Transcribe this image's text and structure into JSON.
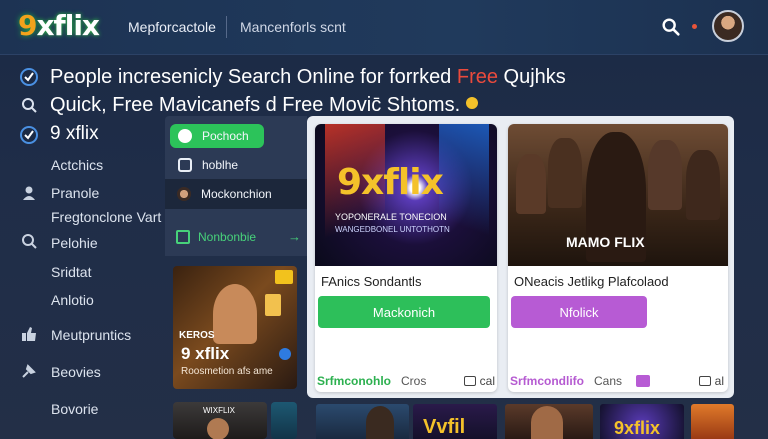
{
  "header": {
    "logo_nine": "9",
    "logo_xflix": "xflix",
    "nav_primary": "Mepforcactole",
    "nav_secondary": "Mancenforls scnt"
  },
  "headline": {
    "line1_main": "People incresenicly Search Online for forrked ",
    "line1_accent": "Free",
    "line1_tail": " Qujhks",
    "line2": "Quick, Free Mavicanefs d Free Movic̄ Shtoms."
  },
  "sidebar": {
    "brand": "9 xflix",
    "items": [
      "Actchics",
      "Pranole",
      "Fregtonclone Vart",
      "Pelohie",
      "Sridtat",
      "Anlotio",
      "Meutpruntics",
      "Beovies",
      "Bovorie"
    ]
  },
  "middle": {
    "items": [
      "Pochoch",
      "hoblhe",
      "Mockonchion"
    ],
    "green_label": "Nonbonbie",
    "arrow": "→",
    "thumb": {
      "badge": "KEROS",
      "title": "9 xflix",
      "caption": "Roosmetion afs ame",
      "bottom_label": "WIXFLIX"
    }
  },
  "cards": [
    {
      "poster_title": "9xflix",
      "poster_sub1": "YOPONERALE TONECION",
      "poster_sub2": "WANGEDBONEL UNTOTHOTN",
      "title": "FAnics Sondantls",
      "cta": "Mackonich",
      "cta_color": "#2dbf5a",
      "foot_label": "Srfmconohlo",
      "foot_label_color": "#2cb04f",
      "foot_mid": "Cros",
      "foot_right": "cal"
    },
    {
      "poster_title": "MAMO FLIX",
      "title": "ONeacis Jetlikg Plafcolaod",
      "cta": "Nfolick",
      "cta_color": "#b75bd4",
      "foot_label": "Srfmcondlifo",
      "foot_label_color": "#b55ad1",
      "foot_mid": "Cans",
      "foot_right": "al"
    }
  ],
  "strip": {
    "item2": "Vvfil",
    "item4": "9xflix"
  }
}
